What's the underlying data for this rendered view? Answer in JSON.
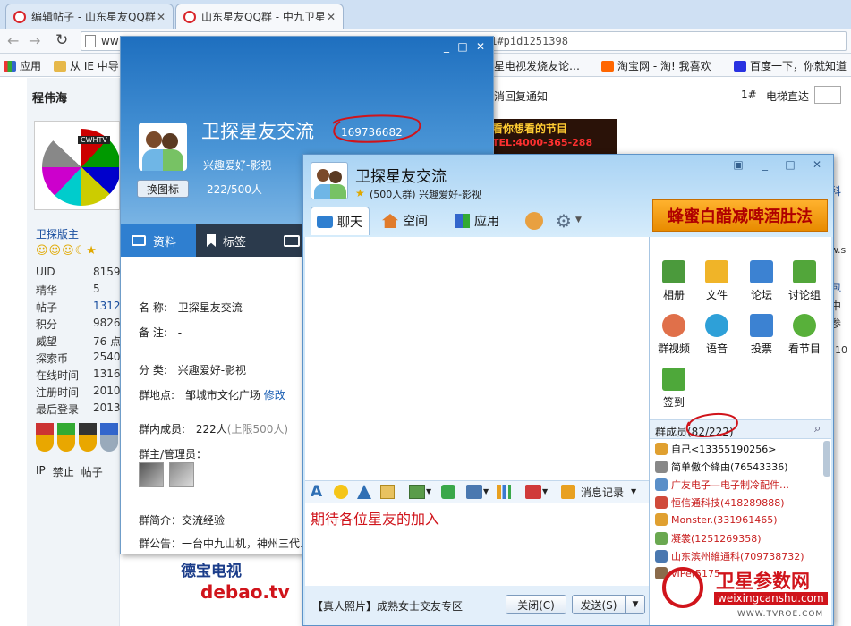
{
  "browser": {
    "tabs": [
      {
        "title": "编辑帖子 - 山东星友QQ群"
      },
      {
        "title": "山东星友QQ群 - 中九卫星"
      }
    ],
    "address": "ww",
    "address_tail": "#1#pid1251398",
    "bookmarks": [
      "应用",
      "从 IE 中导",
      "卫星电视发烧友论…",
      "淘宝网 - 淘! 我喜欢",
      "百度一下，你就知道"
    ]
  },
  "forum": {
    "username": "程伟海",
    "logo_text": "CWHTV",
    "rank": "卫探版主",
    "stats": [
      {
        "label": "UID",
        "value": "8159"
      },
      {
        "label": "精华",
        "value": "5"
      },
      {
        "label": "帖子",
        "value": "1312"
      },
      {
        "label": "积分",
        "value": "9826"
      },
      {
        "label": "威望",
        "value": "76 点"
      },
      {
        "label": "探索币",
        "value": "2540"
      },
      {
        "label": "在线时间",
        "value": "1316"
      },
      {
        "label": "注册时间",
        "value": "2010-"
      },
      {
        "label": "最后登录",
        "value": "2013-"
      }
    ],
    "actions": [
      "IP",
      "禁止",
      "帖子"
    ],
    "notify": "消回复通知",
    "floor": "1#",
    "elevator": "电梯直达",
    "banner_top": "看你想看的节目",
    "banner_tel": "TEL:4000-365-288",
    "ad_bottom_title": "德宝电视",
    "ad_bottom_domain": "debao.tv",
    "right_snips": [
      "科",
      "w.s",
      "包",
      "中",
      "参",
      "310"
    ]
  },
  "group_info": {
    "name": "卫探星友交流",
    "number": "169736682",
    "category_tag": "兴趣爱好-影视",
    "members_count": "222/500人",
    "change_icon": "换图标",
    "tabs": [
      "资料",
      "标签"
    ],
    "fields": [
      {
        "label": "名    称:",
        "value": "卫探星友交流"
      },
      {
        "label": "备    注:",
        "value": "-"
      },
      {
        "label": "分    类:",
        "value": "兴趣爱好-影视"
      },
      {
        "label": "群地点:",
        "value": "邹城市文化广场"
      },
      {
        "label": "群内成员:",
        "value": "222人"
      }
    ],
    "location_edit": "修改",
    "member_limit": "(上限500人)",
    "admins_label": "群主/管理员：",
    "intro_label": "群简介：",
    "intro": "交流经验",
    "notice_label": "群公告：",
    "notice": "一台中九山机，神州三代…"
  },
  "chat": {
    "title": "卫探星友交流",
    "subtitle": "(500人群)  兴趣爱好-影视",
    "tabs": [
      "聊天",
      "空间",
      "应用"
    ],
    "ad": "蜂蜜白醋减啤酒肚法",
    "input_text": "期待各位星友的加入",
    "msg_record": "消息记录",
    "footer_ad": "【真人照片】成熟女士交友专区",
    "close_btn": "关闭(C)",
    "send_btn": "发送(S)",
    "apps": [
      "相册",
      "文件",
      "论坛",
      "讨论组",
      "群视频",
      "语音",
      "投票",
      "看节目",
      "签到"
    ],
    "members_header": "群成员(82/222)",
    "members": [
      {
        "name": "自己<13355190256>",
        "color": "#111111"
      },
      {
        "name": "简单傲个絳由(76543336)",
        "color": "#111111"
      },
      {
        "name": "广友电子—电子制冷配件…",
        "color": "#c81e1e"
      },
      {
        "name": "恒信通科技(418289888)",
        "color": "#c81e1e"
      },
      {
        "name": "Monster.(331961465)",
        "color": "#c81e1e"
      },
      {
        "name": "凝裳(1251269358)",
        "color": "#c81e1e"
      },
      {
        "name": "山东滨州維通科(709738732)",
        "color": "#c81e1e"
      },
      {
        "name": "vIPe(5175",
        "color": "#c81e1e"
      }
    ]
  },
  "watermark": {
    "title": "卫星参数网",
    "url": "weixingcanshu.com",
    "sub": "WWW.TVROE.COM"
  },
  "colors": {
    "accent": "#2f7fd0",
    "annotation": "#d0141b",
    "member_red": "#c81e1e"
  }
}
